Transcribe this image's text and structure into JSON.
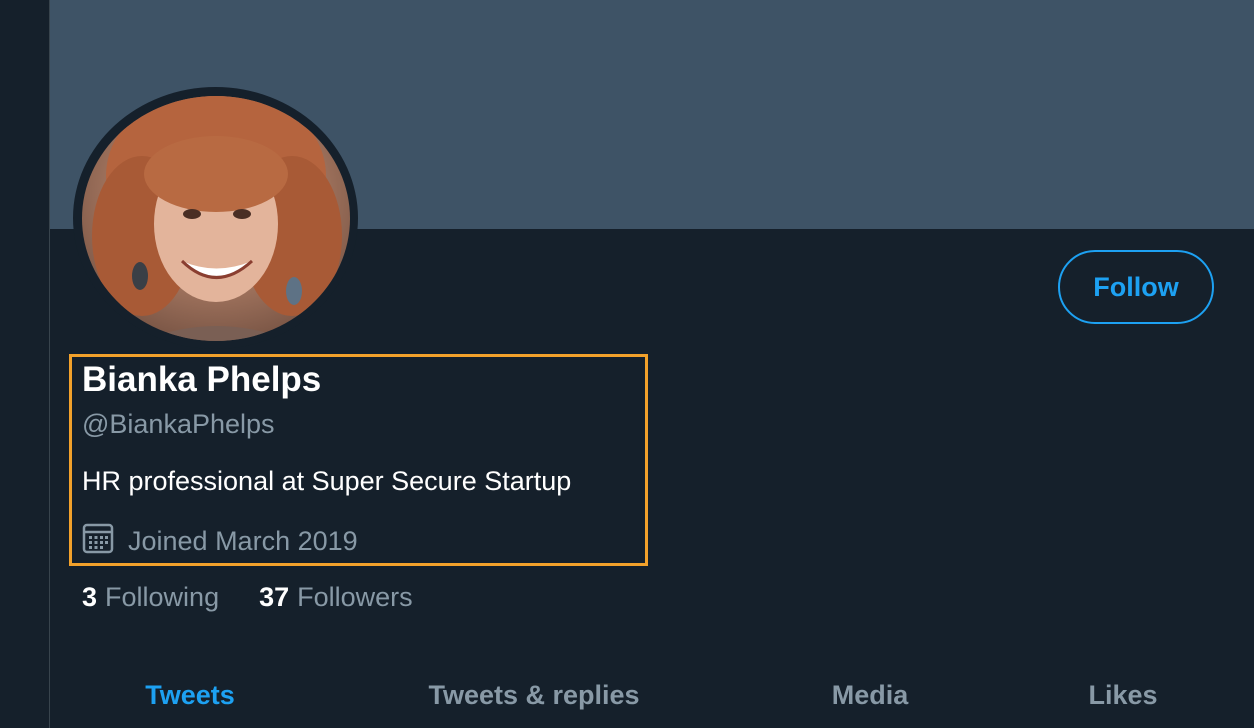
{
  "profile": {
    "display_name": "Bianka Phelps",
    "handle": "@BiankaPhelps",
    "bio": "HR professional at Super Secure Startup",
    "joined": "Joined March 2019",
    "joined_icon": "calendar-icon"
  },
  "actions": {
    "follow_label": "Follow"
  },
  "stats": {
    "following_count": "3",
    "following_label": "Following",
    "followers_count": "37",
    "followers_label": "Followers"
  },
  "tabs": [
    {
      "label": "Tweets",
      "active": true
    },
    {
      "label": "Tweets & replies",
      "active": false
    },
    {
      "label": "Media",
      "active": false
    },
    {
      "label": "Likes",
      "active": false
    }
  ],
  "colors": {
    "background": "#15202b",
    "banner": "#3e5366",
    "accent": "#1da1f2",
    "highlight": "#f2a12b",
    "secondary_text": "#8899a6"
  }
}
